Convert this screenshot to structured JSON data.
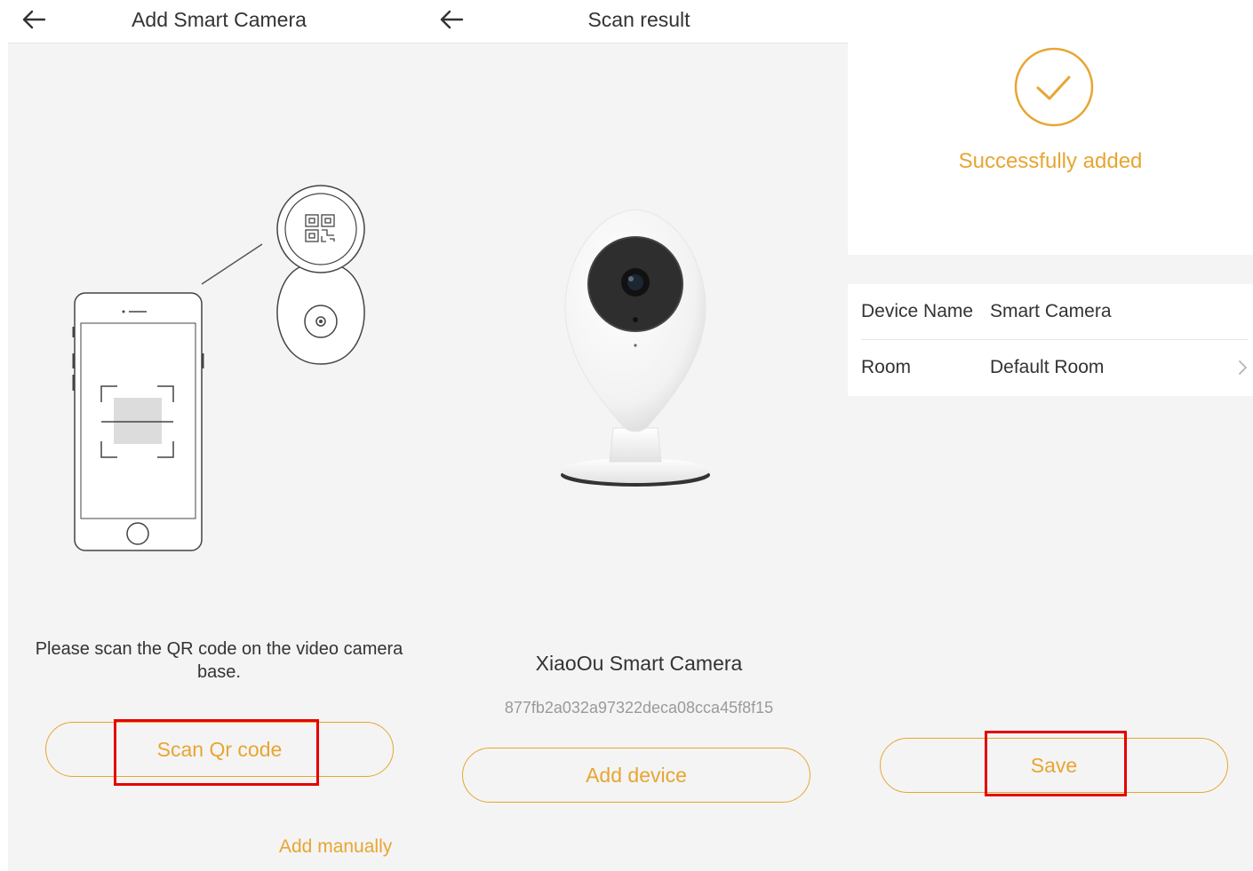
{
  "screen1": {
    "title": "Add Smart Camera",
    "instruction": "Please scan the QR code on the video camera base.",
    "scan_button": "Scan Qr code",
    "add_manually_link": "Add manually"
  },
  "screen2": {
    "title": "Scan result",
    "device_name": "XiaoOu Smart Camera",
    "device_id": "877fb2a032a97322deca08cca45f8f15",
    "add_device_button": "Add device"
  },
  "screen3": {
    "status": "Successfully added",
    "device_name_label": "Device Name",
    "device_name_value": "Smart Camera",
    "room_label": "Room",
    "room_value": "Default Room",
    "save_button": "Save"
  },
  "colors": {
    "accent": "#e8a532",
    "highlight": "#e60000",
    "panel_background": "#f4f4f4",
    "text": "#333333"
  }
}
